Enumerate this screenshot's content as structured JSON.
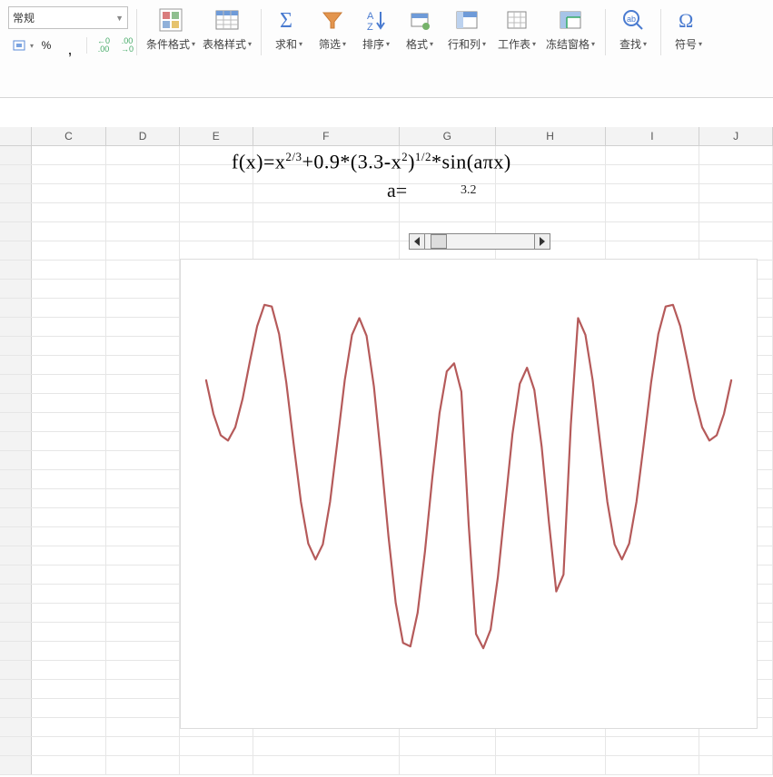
{
  "ribbon": {
    "number_format_selected": "常规",
    "toolbar": {
      "currency_glyph": "⎙",
      "percent": "%",
      "comma": ",",
      "inc_dec_1": "←0\n.00",
      "inc_dec_2": ".00\n→0"
    },
    "buttons": {
      "conditional_format": "条件格式",
      "table_styles": "表格样式",
      "sum": "求和",
      "filter": "筛选",
      "sort": "排序",
      "format": "格式",
      "rows_cols": "行和列",
      "worksheet": "工作表",
      "freeze_panes": "冻结窗格",
      "find": "查找",
      "symbol": "符号"
    }
  },
  "sheet": {
    "columns": [
      "C",
      "D",
      "E",
      "F",
      "G",
      "H",
      "I",
      "J"
    ],
    "formula_html": "f(x)=x<sup>2/3</sup>+0.9*(3.3-x<sup>2</sup>)<sup>1/2</sup>*sin(aπx)",
    "a_label": "a=",
    "a_value": "3.2"
  },
  "chart_data": {
    "type": "line",
    "title": "",
    "xlabel": "",
    "ylabel": "",
    "xlim": [
      -1.8,
      1.8
    ],
    "ylim": [
      -1.8,
      2.5
    ],
    "series": [
      {
        "name": "f(x)",
        "color": "#b55a5a",
        "x": [
          -1.8,
          -1.75,
          -1.7,
          -1.65,
          -1.6,
          -1.55,
          -1.5,
          -1.45,
          -1.4,
          -1.35,
          -1.3,
          -1.25,
          -1.2,
          -1.15,
          -1.1,
          -1.05,
          -1.0,
          -0.95,
          -0.9,
          -0.85,
          -0.8,
          -0.75,
          -0.7,
          -0.65,
          -0.6,
          -0.55,
          -0.5,
          -0.45,
          -0.4,
          -0.35,
          -0.3,
          -0.25,
          -0.2,
          -0.15,
          -0.1,
          -0.05,
          0.0,
          0.05,
          0.1,
          0.15,
          0.2,
          0.25,
          0.3,
          0.35,
          0.4,
          0.45,
          0.5,
          0.55,
          0.6,
          0.65,
          0.7,
          0.75,
          0.8,
          0.85,
          0.9,
          0.95,
          1.0,
          1.05,
          1.1,
          1.15,
          1.2,
          1.25,
          1.3,
          1.35,
          1.4,
          1.45,
          1.5,
          1.55,
          1.6,
          1.65,
          1.7,
          1.75,
          1.8
        ],
        "values": [
          1.63,
          1.25,
          1.01,
          0.95,
          1.1,
          1.42,
          1.84,
          2.24,
          2.48,
          2.46,
          2.15,
          1.6,
          0.91,
          0.26,
          -0.21,
          -0.39,
          -0.22,
          0.26,
          0.94,
          1.63,
          2.14,
          2.33,
          2.13,
          1.56,
          0.75,
          -0.13,
          -0.88,
          -1.33,
          -1.37,
          -0.99,
          -0.3,
          0.52,
          1.26,
          1.73,
          1.82,
          1.5,
          0.0,
          -1.23,
          -1.39,
          -1.18,
          -0.59,
          0.22,
          1.02,
          1.59,
          1.77,
          1.52,
          0.88,
          0.03,
          -0.75,
          -0.56,
          1.13,
          2.33,
          2.14,
          1.63,
          0.94,
          0.26,
          -0.22,
          -0.39,
          -0.21,
          0.26,
          0.91,
          1.6,
          2.15,
          2.46,
          2.48,
          2.24,
          1.84,
          1.42,
          1.1,
          0.95,
          1.01,
          1.25,
          1.63
        ]
      }
    ]
  }
}
